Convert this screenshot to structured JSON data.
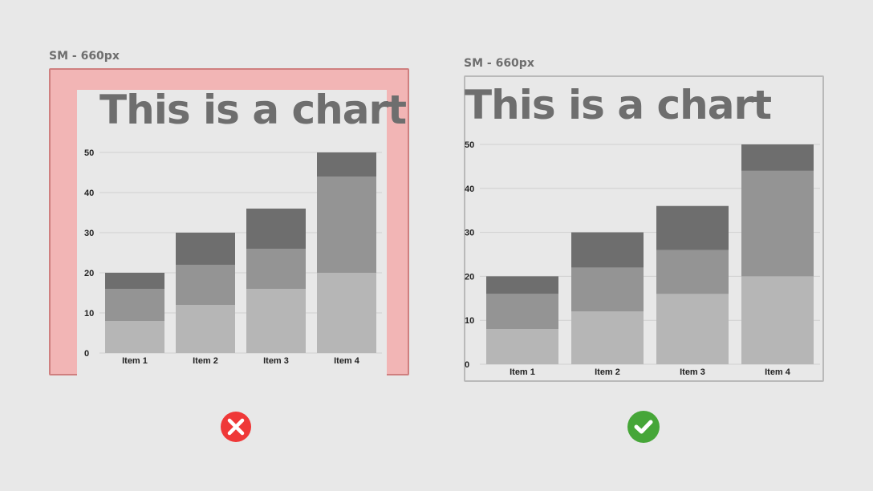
{
  "panels": [
    {
      "label": "SM - 660px",
      "verdict": "incorrect",
      "icon": "x-circle-icon",
      "chart_title": "This is a chart"
    },
    {
      "label": "SM - 660px",
      "verdict": "correct",
      "icon": "check-circle-icon",
      "chart_title": "This is a chart"
    }
  ],
  "colors": {
    "background": "#e8e8e8",
    "overflow_highlight": "#f2b5b5",
    "series_1": "#b6b6b6",
    "series_2": "#949494",
    "series_3": "#6e6e6e",
    "incorrect": "#ef3838",
    "correct": "#46a638"
  },
  "chart_data": [
    {
      "type": "bar",
      "stacked": true,
      "title": "This is a chart",
      "categories": [
        "Item 1",
        "Item 2",
        "Item 3",
        "Item 4"
      ],
      "series": [
        {
          "values": [
            8,
            12,
            16,
            20
          ]
        },
        {
          "values": [
            8,
            10,
            10,
            24
          ]
        },
        {
          "values": [
            4,
            8,
            10,
            6
          ]
        }
      ],
      "ylim": [
        0,
        50
      ],
      "yticks": [
        0,
        10,
        20,
        30,
        40,
        50
      ],
      "grid": true,
      "legend": "none"
    },
    {
      "type": "bar",
      "stacked": true,
      "title": "This is a chart",
      "categories": [
        "Item 1",
        "Item 2",
        "Item 3",
        "Item 4"
      ],
      "series": [
        {
          "values": [
            8,
            12,
            16,
            20
          ]
        },
        {
          "values": [
            8,
            10,
            10,
            24
          ]
        },
        {
          "values": [
            4,
            8,
            10,
            6
          ]
        }
      ],
      "ylim": [
        0,
        50
      ],
      "yticks": [
        0,
        10,
        20,
        30,
        40,
        50
      ],
      "grid": true,
      "legend": "none"
    }
  ]
}
